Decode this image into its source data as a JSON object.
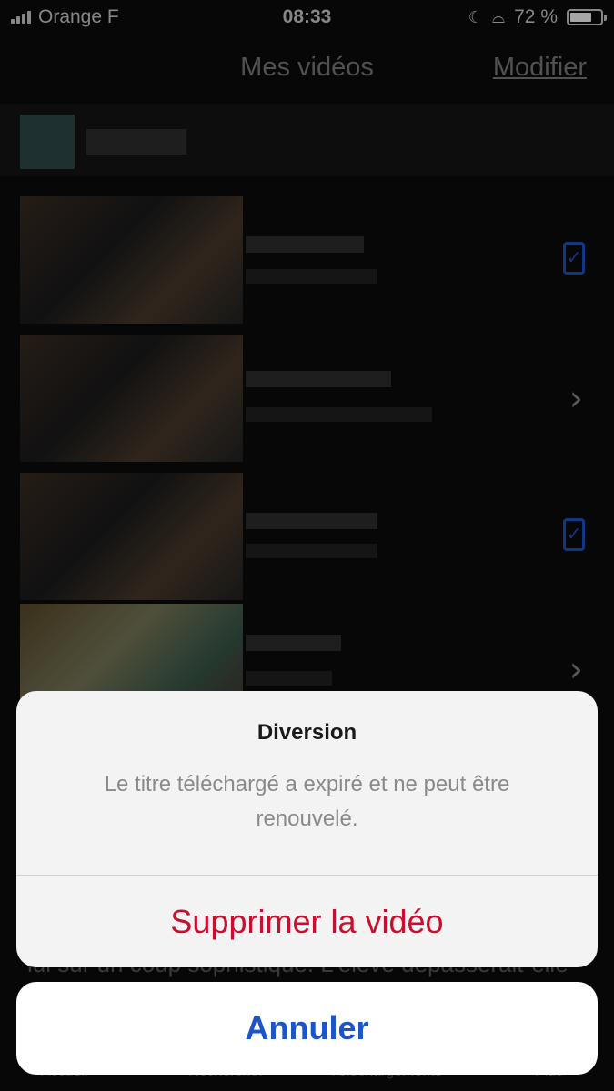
{
  "status_bar": {
    "carrier": "Orange F",
    "time": "08:33",
    "battery": "72 %",
    "battery_level": 0.72
  },
  "nav": {
    "title": "Mes vidéos",
    "edit": "Modifier"
  },
  "background_text": "lui sur un coup sophistiqué. L'élève dépasserait-elle",
  "tabs": [
    "Accueil",
    "Rechercher",
    "Téléchargements",
    "Plus"
  ],
  "action_sheet": {
    "title": "Diversion",
    "message": "Le titre téléchargé a expiré et ne peut être renouvelé.",
    "destructive_action": "Supprimer la vidéo",
    "cancel": "Annuler"
  },
  "colors": {
    "destructive": "#c8102e",
    "cancel": "#1a55c9",
    "checkbox": "#1b55c8"
  },
  "icons": {
    "check": "checkbox-checked-icon",
    "chevron": "chevron-right-icon"
  }
}
